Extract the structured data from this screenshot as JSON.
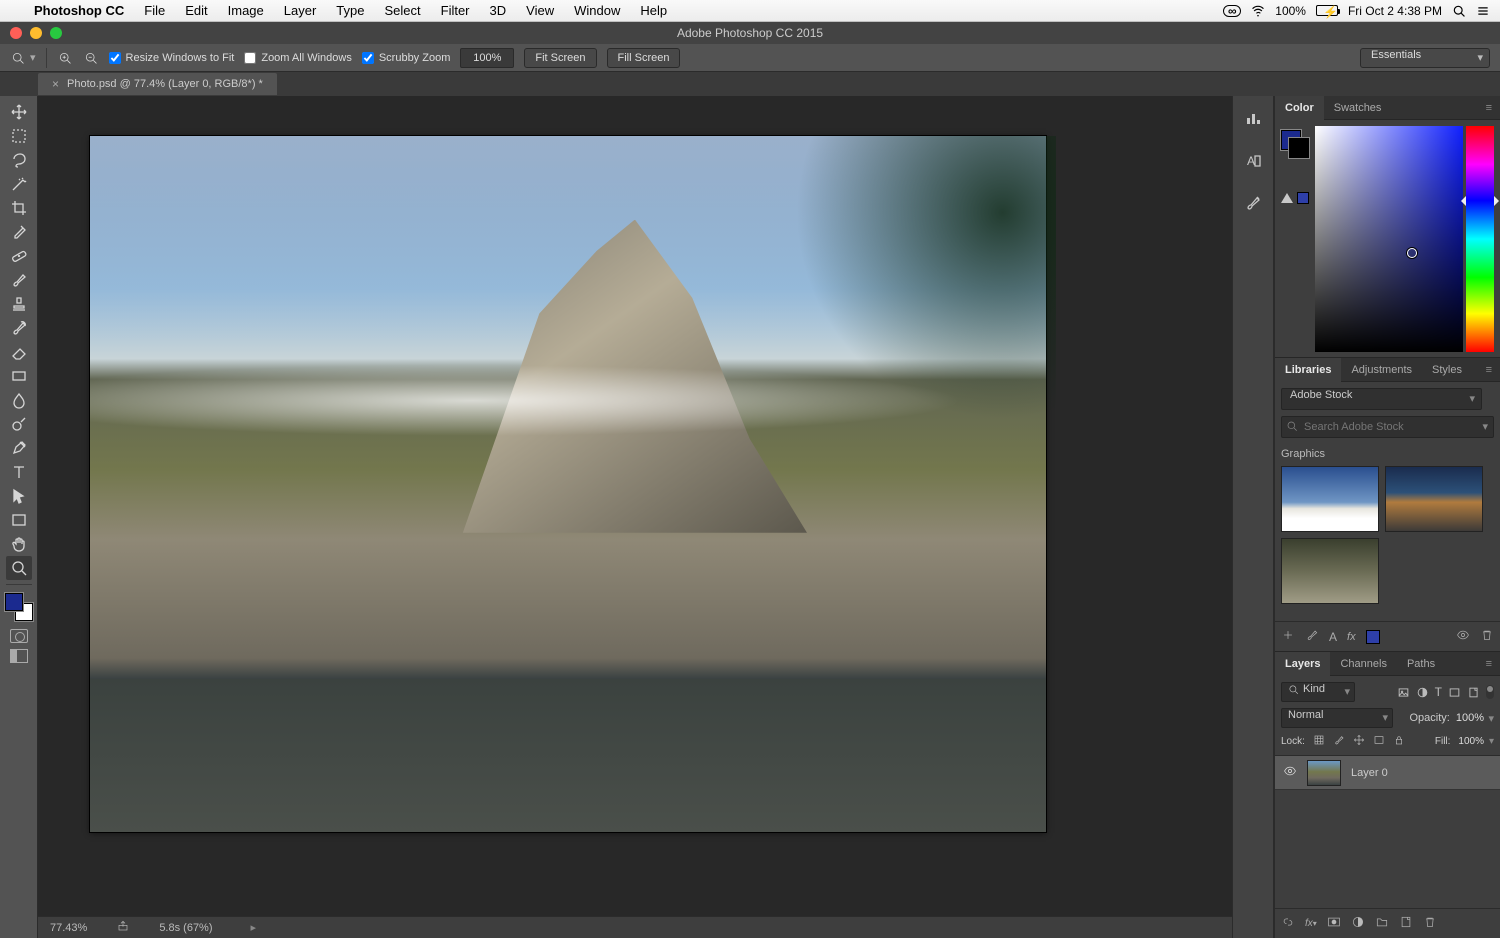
{
  "menubar": {
    "app_name": "Photoshop CC",
    "items": [
      "File",
      "Edit",
      "Image",
      "Layer",
      "Type",
      "Select",
      "Filter",
      "3D",
      "View",
      "Window",
      "Help"
    ],
    "battery_percent": "100%",
    "datetime": "Fri Oct 2  4:38 PM"
  },
  "titlebar": {
    "title": "Adobe Photoshop CC 2015"
  },
  "options_bar": {
    "resize_label": "Resize Windows to Fit",
    "zoom_all_label": "Zoom All Windows",
    "scrubby_label": "Scrubby Zoom",
    "zoom_value": "100%",
    "fit_screen": "Fit Screen",
    "fill_screen": "Fill Screen",
    "workspace_label": "Essentials"
  },
  "document_tab": {
    "label": "Photo.psd @ 77.4% (Layer 0, RGB/8*) *"
  },
  "toolbar": {
    "tools": [
      {
        "id": "move-tool",
        "svg": "move"
      },
      {
        "id": "rectangular-marquee-tool",
        "svg": "marquee"
      },
      {
        "id": "lasso-tool",
        "svg": "lasso"
      },
      {
        "id": "quick-selection-tool",
        "svg": "wand"
      },
      {
        "id": "crop-tool",
        "svg": "crop"
      },
      {
        "id": "eyedropper-tool",
        "svg": "eyedrop"
      },
      {
        "id": "spot-healing-brush-tool",
        "svg": "bandage"
      },
      {
        "id": "brush-tool",
        "svg": "brush"
      },
      {
        "id": "clone-stamp-tool",
        "svg": "stamp"
      },
      {
        "id": "history-brush-tool",
        "svg": "hist"
      },
      {
        "id": "eraser-tool",
        "svg": "eraser"
      },
      {
        "id": "gradient-tool",
        "svg": "gradient"
      },
      {
        "id": "blur-tool",
        "svg": "drop"
      },
      {
        "id": "dodge-tool",
        "svg": "dodge"
      },
      {
        "id": "pen-tool",
        "svg": "pen"
      },
      {
        "id": "type-tool",
        "svg": "type"
      },
      {
        "id": "path-selection-tool",
        "svg": "arrow"
      },
      {
        "id": "rectangle-tool",
        "svg": "rect"
      },
      {
        "id": "hand-tool",
        "svg": "hand"
      },
      {
        "id": "zoom-tool",
        "svg": "zoom",
        "active": true
      }
    ]
  },
  "statusbar": {
    "zoom": "77.43%",
    "timing": "5.8s (67%)"
  },
  "panels": {
    "color": {
      "tabs": [
        "Color",
        "Swatches"
      ],
      "active": 0
    },
    "libraries": {
      "tabs": [
        "Libraries",
        "Adjustments",
        "Styles"
      ],
      "active": 0,
      "library_name": "Adobe Stock",
      "search_placeholder": "Search Adobe Stock",
      "section": "Graphics"
    },
    "layers": {
      "tabs": [
        "Layers",
        "Channels",
        "Paths"
      ],
      "active": 0,
      "filter_kind": "Kind",
      "blend_mode": "Normal",
      "opacity_label": "Opacity:",
      "opacity_value": "100%",
      "lock_label": "Lock:",
      "fill_label": "Fill:",
      "fill_value": "100%",
      "layer0_name": "Layer 0"
    }
  },
  "colors": {
    "foreground": "#1b2a8f",
    "background": "#ffffff"
  }
}
